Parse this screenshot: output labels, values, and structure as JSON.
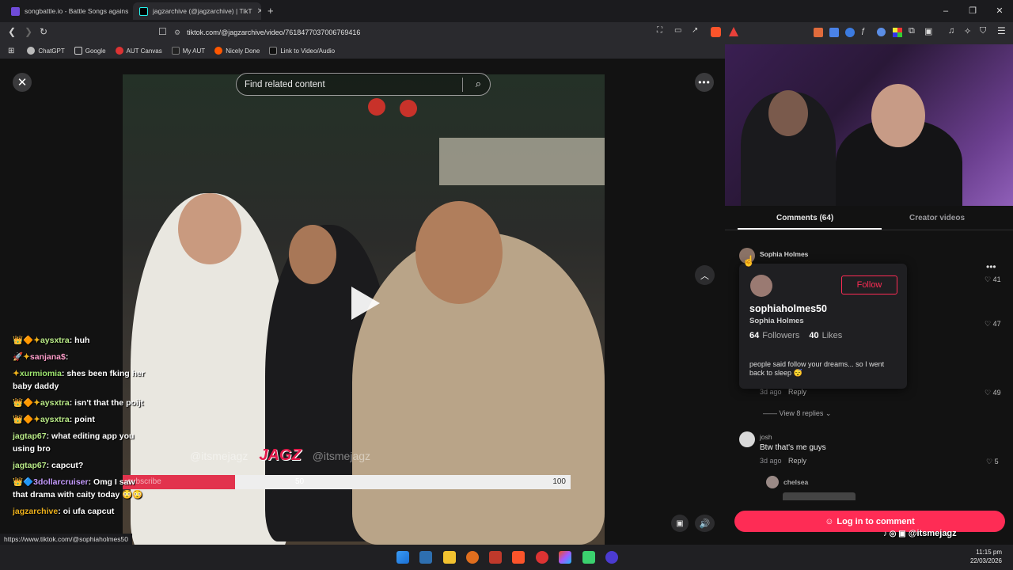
{
  "browser": {
    "tabs": [
      {
        "title": "songbattle.io - Battle Songs against e",
        "active": false
      },
      {
        "title": "jagzarchive (@jagzarchive) | TikT",
        "active": true
      }
    ],
    "new_tab": "+",
    "url": "tiktok.com/@jagzarchive/video/7618477037006769416",
    "bookmarks": [
      "ChatGPT",
      "Google",
      "AUT Canvas",
      "My AUT",
      "Nicely Done",
      "Link to Video/Audio"
    ],
    "status_link": "https://www.tiktok.com/@sophiaholmes50",
    "window_controls": [
      "–",
      "❐",
      "✕"
    ]
  },
  "player": {
    "search_placeholder": "Find related content",
    "close": "✕",
    "more": "•••",
    "watermark_handle_1": "@itsmejagz",
    "watermark_logo": "JAGZ",
    "watermark_handle_2": "@itsmejagz",
    "overlay_bar": {
      "left_label": "subscribe",
      "mid_value": "50",
      "max_value": "100",
      "fill": 0.5
    }
  },
  "chat": [
    {
      "user": "aysxtra",
      "text": "huh",
      "color": "#b8e986",
      "badges": "👑🔶✦"
    },
    {
      "user": "sanjana$",
      "text": "",
      "color": "#ff9ecb",
      "badges": "🚀✦"
    },
    {
      "user": "xurmiomia",
      "text": "shes been fking her baby daddy",
      "color": "#9fe870",
      "badges": "✦"
    },
    {
      "user": "aysxtra",
      "text": "isn't that the poijt",
      "color": "#b8e986",
      "badges": "👑🔶✦"
    },
    {
      "user": "aysxtra",
      "text": "point",
      "color": "#b8e986",
      "badges": "👑🔶✦"
    },
    {
      "user": "jagtap67",
      "text": "what editing app you using bro",
      "color": "#b8e986",
      "badges": ""
    },
    {
      "user": "jagtap67",
      "text": "capcut?",
      "color": "#b8e986",
      "badges": ""
    },
    {
      "user": "3dollarcruiser",
      "text": "Omg I saw that drama with caity today 😳😳",
      "color": "#c69cff",
      "badges": "👑🔷"
    },
    {
      "user": "jagzarchive",
      "text": "oi ufa capcut",
      "color": "#f0b31c",
      "badges": ""
    }
  ],
  "panel": {
    "tab_comments": "Comments (64)",
    "tab_creator": "Creator videos",
    "comments": [
      {
        "name": "Sophia Holmes",
        "likes": "41"
      },
      {
        "likes": "47"
      },
      {
        "meta": "3d ago",
        "reply": "Reply",
        "likes": "49"
      },
      {
        "name": "josh",
        "text": "Btw that's me guys",
        "meta": "3d ago",
        "reply": "Reply",
        "likes": "5"
      },
      {
        "name": "chelsea"
      }
    ],
    "view_replies": "View 8 replies",
    "popup": {
      "username": "sophiaholmes50",
      "display_name": "Sophia Holmes",
      "followers_count": "64",
      "followers_label": "Followers",
      "likes_count": "40",
      "likes_label": "Likes",
      "bio": "people said follow your dreams... so I went back to sleep 😴",
      "follow": "Follow"
    },
    "login_button": "Log in to comment"
  },
  "stream_overlay_handle": "@itsmejagz",
  "clock": {
    "time": "11:15 pm",
    "date": "22/03/2026"
  },
  "colors": {
    "tiktok_red": "#fe2c55",
    "popup_bg": "#1f1f22"
  }
}
